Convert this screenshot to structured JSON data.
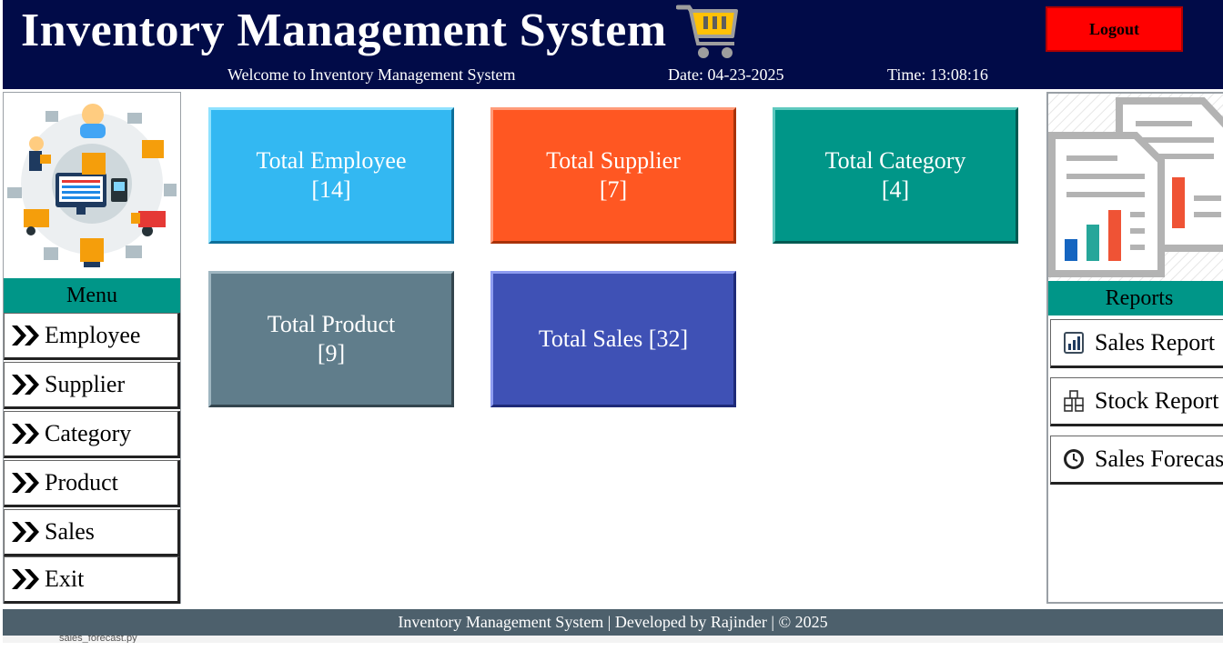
{
  "header": {
    "title": "Inventory Management System",
    "welcome": "Welcome to Inventory Management System",
    "date": "Date: 04-23-2025",
    "time": "Time: 13:08:16",
    "logout_label": "Logout",
    "cart_icon": "shopping-cart-icon"
  },
  "menu": {
    "title": "Menu",
    "items": [
      {
        "label": "Employee",
        "icon": "double-chevron-right-icon"
      },
      {
        "label": "Supplier",
        "icon": "double-chevron-right-icon"
      },
      {
        "label": "Category",
        "icon": "double-chevron-right-icon"
      },
      {
        "label": "Product",
        "icon": "double-chevron-right-icon"
      },
      {
        "label": "Sales",
        "icon": "double-chevron-right-icon"
      },
      {
        "label": "Exit",
        "icon": "double-chevron-right-icon"
      }
    ]
  },
  "tiles": {
    "employee": {
      "label": "Total Employee",
      "value": "[14]",
      "color": "#33b8f2"
    },
    "supplier": {
      "label": "Total Supplier",
      "value": "[7]",
      "color": "#ff5722"
    },
    "category": {
      "label": "Total Category",
      "value": "[4]",
      "color": "#009688"
    },
    "product": {
      "label": "Total Product",
      "value": "[9]",
      "color": "#607d8b"
    },
    "sales": {
      "label": "Total Sales [32]",
      "color": "#3f51b5"
    }
  },
  "reports": {
    "title": "Reports",
    "items": [
      {
        "label": "Sales Report",
        "icon": "bar-chart-icon"
      },
      {
        "label": "Stock Report",
        "icon": "boxes-icon"
      },
      {
        "label": "Sales Forecast",
        "icon": "clock-icon"
      }
    ]
  },
  "footer": {
    "text": "Inventory Management System | Developed by Rajinder | © 2025"
  },
  "taskbar_peek": {
    "filename": "sales_forecast.py"
  },
  "colors": {
    "header_bg": "#010b48",
    "accent": "#009688",
    "logout": "#ff0000",
    "footer_bg": "#4d606c"
  }
}
